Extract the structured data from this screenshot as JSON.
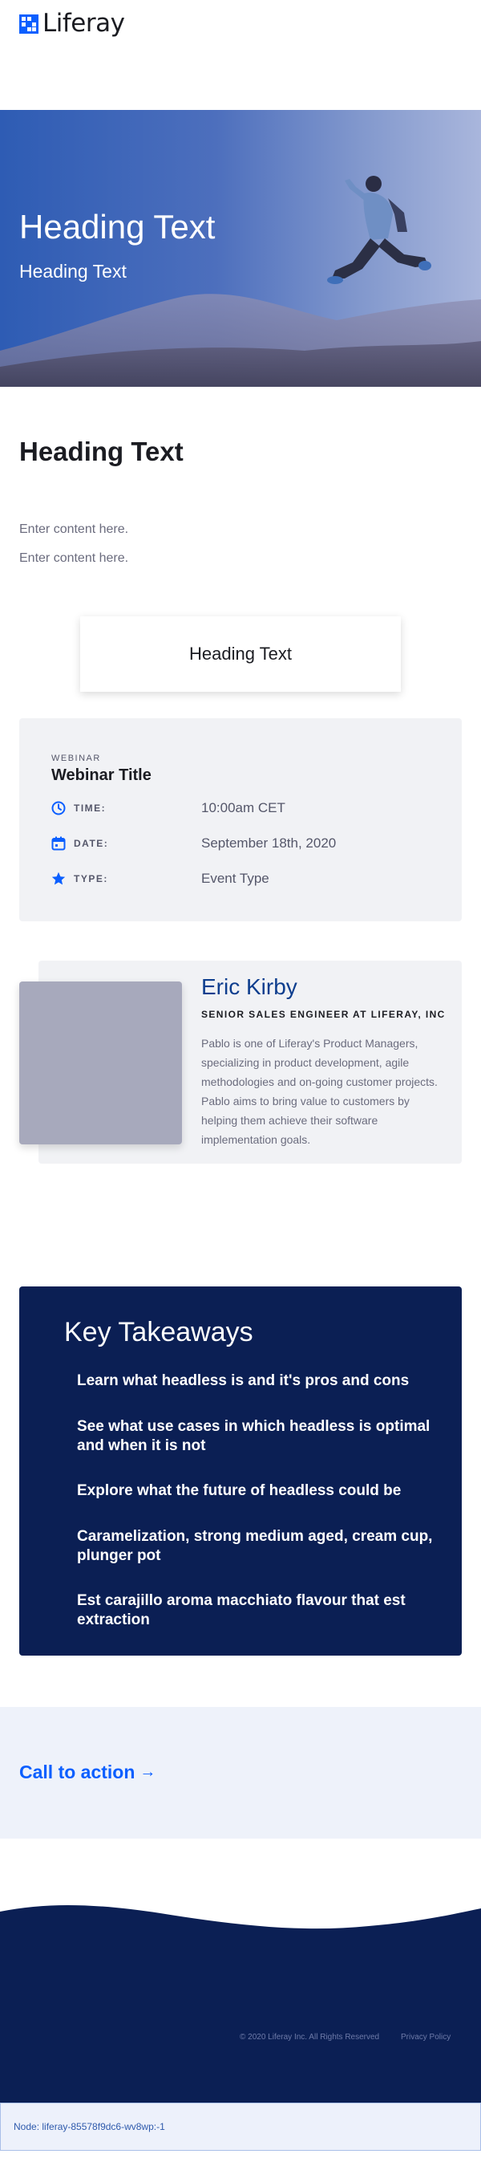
{
  "header": {
    "logo_text": "Liferay"
  },
  "hero": {
    "title": "Heading Text",
    "subtitle": "Heading Text"
  },
  "section": {
    "heading": "Heading Text",
    "content_lines": [
      "Enter content here.",
      "Enter content here."
    ],
    "card_heading": "Heading Text"
  },
  "webinar": {
    "kicker": "WEBINAR",
    "title": "Webinar Title",
    "rows": [
      {
        "icon": "clock-icon",
        "label": "TIME:",
        "value": "10:00am CET"
      },
      {
        "icon": "calendar-icon",
        "label": "DATE:",
        "value": "September 18th, 2020"
      },
      {
        "icon": "star-icon",
        "label": "TYPE:",
        "value": "Event Type"
      }
    ]
  },
  "speaker": {
    "name": "Eric Kirby",
    "role": "SENIOR SALES ENGINEER AT LIFERAY, INC",
    "bio": "Pablo is one of Liferay's Product Managers, specializing in product development, agile methodologies and on-going customer projects. Pablo aims to bring value to customers by helping them achieve their software implementation goals."
  },
  "takeaways": {
    "title": "Key Takeaways",
    "items": [
      "Learn what headless is and it's pros and cons",
      "See what use cases in which headless is optimal and when it is not",
      "Explore what the future of headless could be",
      "Caramelization, strong medium aged, cream cup, plunger pot",
      "Est carajillo aroma macchiato flavour that est extraction"
    ]
  },
  "cta": {
    "label": "Call to action",
    "arrow": "→"
  },
  "footer": {
    "copyright": "© 2020 Liferay Inc. All Rights Reserved",
    "privacy": "Privacy Policy"
  },
  "node_bar": {
    "text": "Node: liferay-85578f9dc6-wv8wp:-1"
  },
  "colors": {
    "brand_blue": "#0b5fff",
    "navy": "#0b1f54",
    "speaker_name": "#0e3e8e"
  }
}
